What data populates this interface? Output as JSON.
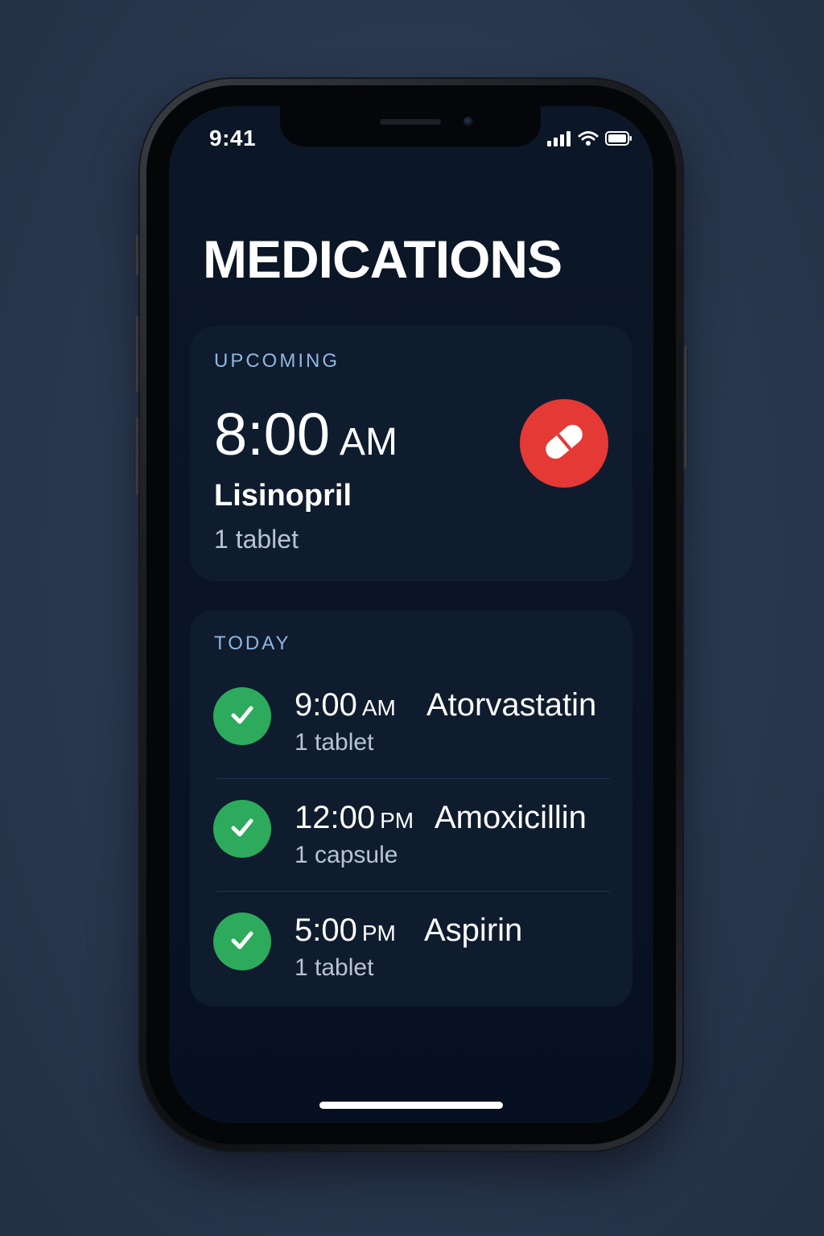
{
  "status_bar": {
    "time": "9:41"
  },
  "page": {
    "title": "MEDICATIONS"
  },
  "upcoming": {
    "label": "UPCOMING",
    "time": "8:00",
    "meridiem": "AM",
    "medication": "Lisinopril",
    "dose": "1 tablet",
    "icon": "pill-icon",
    "accent_color": "#e53935"
  },
  "today": {
    "label": "TODAY",
    "items": [
      {
        "time": "9:00",
        "meridiem": "AM",
        "medication": "Atorvastatin",
        "dose": "1 tablet",
        "status": "taken",
        "icon": "check-icon"
      },
      {
        "time": "12:00",
        "meridiem": "PM",
        "medication": "Amoxicillin",
        "dose": "1 capsule",
        "status": "taken",
        "icon": "check-icon"
      },
      {
        "time": "5:00",
        "meridiem": "PM",
        "medication": "Aspirin",
        "dose": "1 tablet",
        "status": "taken",
        "icon": "check-icon"
      }
    ],
    "check_color": "#2daa5c"
  },
  "colors": {
    "background": "#2b3a52",
    "screen": "#0a1424",
    "card": "#0f1c2e",
    "section_label": "#8fb7e2"
  }
}
